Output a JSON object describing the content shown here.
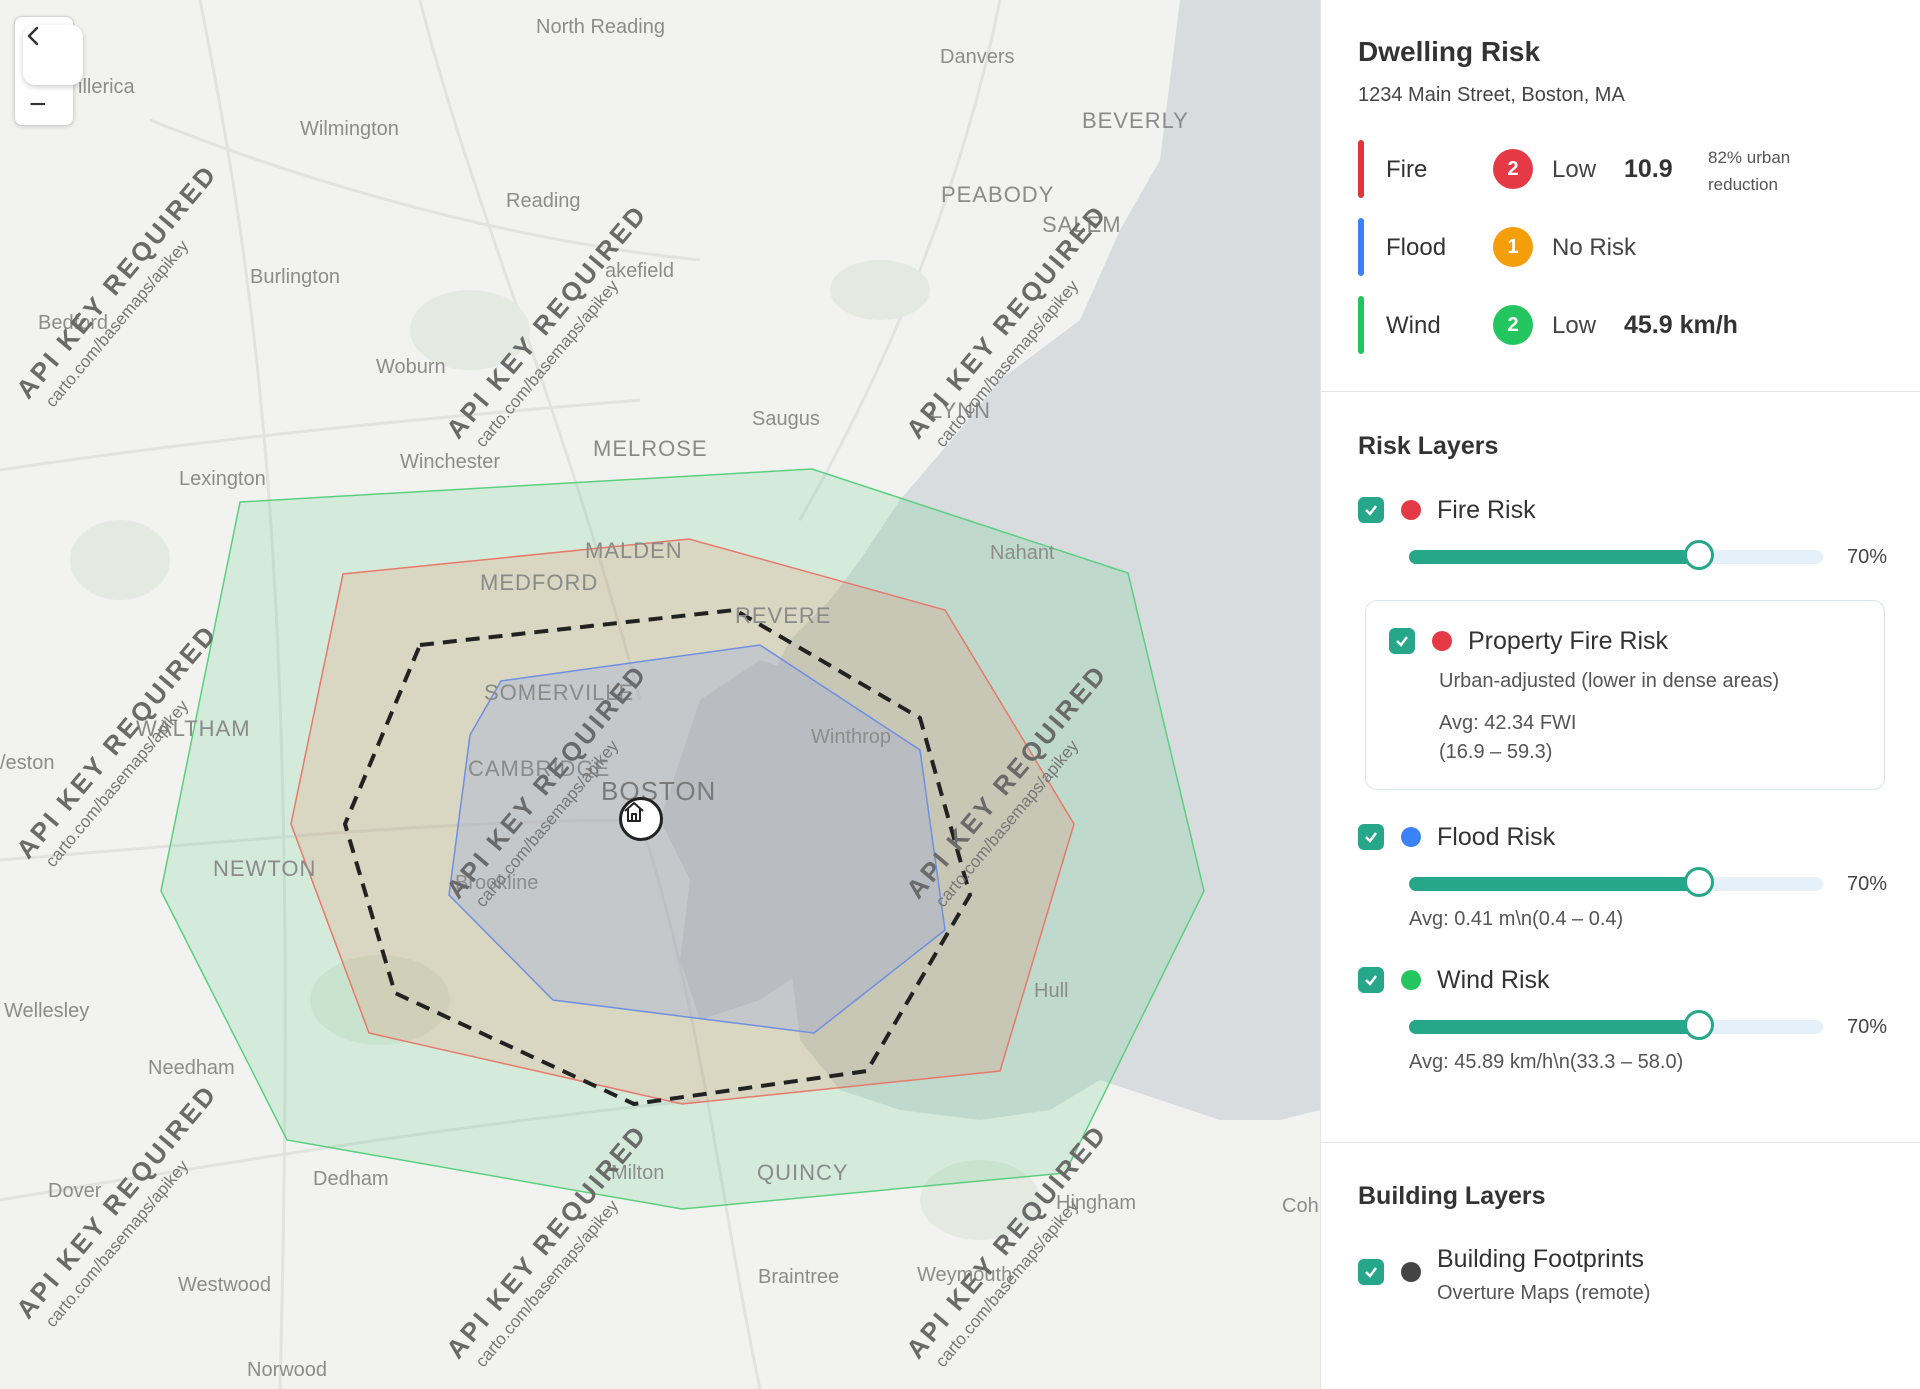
{
  "map": {
    "controls": {
      "back_icon": "chevron-left-icon",
      "zoom_out_label": "−"
    },
    "places": [
      "North Reading",
      "Danvers",
      "illerica",
      "Wilmington",
      "BEVERLY",
      "PEABODY",
      "Reading",
      "SALEM",
      "Burlington",
      "akefield",
      "Bedford",
      "Woburn",
      "Saugus",
      "LYNN",
      "MELROSE",
      "Lexington",
      "Winchester",
      "MALDEN",
      "Nahant",
      "MEDFORD",
      "REVERE",
      "SOMERVILLE",
      "WALTHAM",
      "Winthrop",
      "/eston",
      "CAMBRIDGE",
      "BOSTON",
      "NEWTON",
      "Brookline",
      "Wellesley",
      "Hull",
      "Needham",
      "QUINCY",
      "Dedham",
      "Milton",
      "Dover",
      "Hingham",
      "Coh",
      "Westwood",
      "Braintree",
      "Weymouth",
      "Norwood"
    ],
    "watermark": {
      "title": "API KEY REQUIRED",
      "url": "carto.com/basemaps/apikey"
    },
    "marker_icon": "home-icon"
  },
  "panel": {
    "title": "Dwelling Risk",
    "address": "1234 Main Street, Boston, MA",
    "summary": [
      {
        "name": "Fire",
        "color": "#e0353c",
        "score": "2",
        "badge_color": "#e63946",
        "level": "Low",
        "value": "10.9",
        "note": "82% urban reduction"
      },
      {
        "name": "Flood",
        "color": "#3b82f6",
        "score": "1",
        "badge_color": "#f59e0b",
        "level": "No Risk",
        "value": "",
        "note": ""
      },
      {
        "name": "Wind",
        "color": "#22c55e",
        "score": "2",
        "badge_color": "#22c55e",
        "level": "Low",
        "value": "45.9 km/h",
        "note": ""
      }
    ],
    "risk_layers": {
      "heading": "Risk Layers",
      "fire": {
        "label": "Fire Risk",
        "dot": "#e63946",
        "opacity": 70,
        "opacity_label": "70%"
      },
      "property_fire": {
        "label": "Property Fire Risk",
        "dot": "#e63946",
        "description": "Urban-adjusted (lower in dense areas)",
        "avg": "Avg: 42.34 FWI",
        "range": "(16.9 – 59.3)"
      },
      "flood": {
        "label": "Flood Risk",
        "dot": "#3b82f6",
        "opacity": 70,
        "opacity_label": "70%",
        "avg": "Avg: 0.41 m\\n(0.4 – 0.4)"
      },
      "wind": {
        "label": "Wind Risk",
        "dot": "#22c55e",
        "opacity": 70,
        "opacity_label": "70%",
        "avg": "Avg: 45.89 km/h\\n(33.3 – 58.0)"
      }
    },
    "building_layers": {
      "heading": "Building Layers",
      "footprints": {
        "label": "Building Footprints",
        "dot": "#444444",
        "source": "Overture Maps (remote)"
      }
    },
    "accent": "#26a78a"
  }
}
